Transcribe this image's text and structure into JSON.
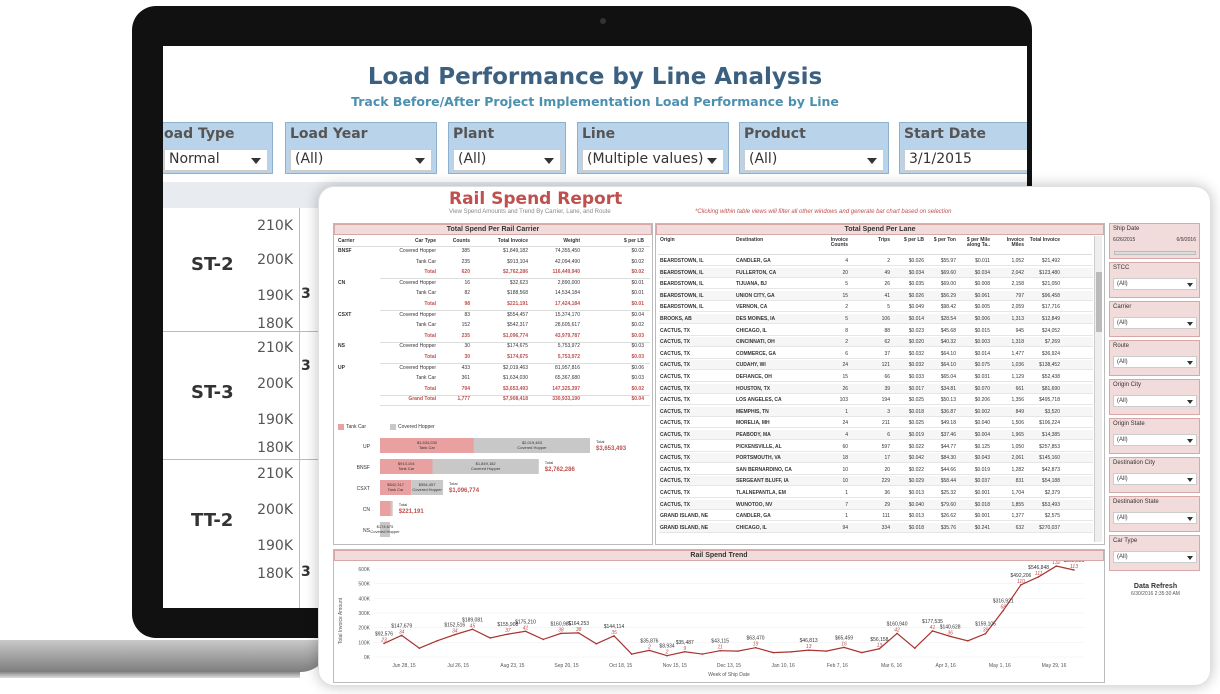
{
  "back_dashboard": {
    "title": "Load Performance by Line Analysis",
    "subtitle": "Track Before/After Project Implementation Load Performance by Line",
    "filters": [
      {
        "label": "oad Type",
        "value": "Normal"
      },
      {
        "label": "Load Year",
        "value": "(All)"
      },
      {
        "label": "Plant",
        "value": "(All)"
      },
      {
        "label": "Line",
        "value": "(Multiple values)"
      },
      {
        "label": "Product",
        "value": "(All)"
      },
      {
        "label": "Start Date",
        "value": "3/1/2015"
      }
    ],
    "rows": [
      {
        "name": "ST-2",
        "ticks": [
          "210K",
          "200K",
          "190K",
          "180K"
        ],
        "stub": "3"
      },
      {
        "name": "ST-3",
        "ticks": [
          "210K",
          "200K",
          "190K",
          "180K"
        ],
        "stub": "3"
      },
      {
        "name": "TT-2",
        "ticks": [
          "210K",
          "200K",
          "190K",
          "180K"
        ],
        "stub": "3"
      }
    ]
  },
  "report": {
    "title": "Rail Spend Report",
    "subtitle": "View Spend Amounts and Trend By Carrier, Lane, and Route",
    "note": "*Clicking within table views will filter all other windows and generate bar chart based on selection",
    "carrier_table": {
      "header": "Total Spend Per Rail Carrier",
      "columns": [
        "Carrier",
        "Car Type",
        "Counts",
        "Total Invoice",
        "Weight",
        "$ per LB"
      ],
      "rows": [
        {
          "carrier": "BNSF",
          "type": "Covered Hopper",
          "counts": "385",
          "invoice": "$1,849,182",
          "weight": "74,355,450",
          "perlb": "$0.02",
          "kind": "n"
        },
        {
          "carrier": "",
          "type": "Tank Car",
          "counts": "235",
          "invoice": "$913,104",
          "weight": "42,094,490",
          "perlb": "$0.02",
          "kind": "n"
        },
        {
          "carrier": "",
          "type": "Total",
          "counts": "620",
          "invoice": "$2,762,286",
          "weight": "116,449,940",
          "perlb": "$0.02",
          "kind": "t"
        },
        {
          "carrier": "CN",
          "type": "Covered Hopper",
          "counts": "16",
          "invoice": "$32,623",
          "weight": "2,890,000",
          "perlb": "$0.01",
          "kind": "n"
        },
        {
          "carrier": "",
          "type": "Tank Car",
          "counts": "82",
          "invoice": "$188,568",
          "weight": "14,534,184",
          "perlb": "$0.01",
          "kind": "n"
        },
        {
          "carrier": "",
          "type": "Total",
          "counts": "98",
          "invoice": "$221,191",
          "weight": "17,424,184",
          "perlb": "$0.01",
          "kind": "t"
        },
        {
          "carrier": "CSXT",
          "type": "Covered Hopper",
          "counts": "83",
          "invoice": "$554,457",
          "weight": "15,374,170",
          "perlb": "$0.04",
          "kind": "n"
        },
        {
          "carrier": "",
          "type": "Tank Car",
          "counts": "152",
          "invoice": "$542,317",
          "weight": "28,605,617",
          "perlb": "$0.02",
          "kind": "n"
        },
        {
          "carrier": "",
          "type": "Total",
          "counts": "235",
          "invoice": "$1,096,774",
          "weight": "43,979,787",
          "perlb": "$0.03",
          "kind": "t"
        },
        {
          "carrier": "NS",
          "type": "Covered Hopper",
          "counts": "30",
          "invoice": "$174,675",
          "weight": "5,753,972",
          "perlb": "$0.03",
          "kind": "n"
        },
        {
          "carrier": "",
          "type": "Total",
          "counts": "30",
          "invoice": "$174,675",
          "weight": "5,753,972",
          "perlb": "$0.03",
          "kind": "t"
        },
        {
          "carrier": "UP",
          "type": "Covered Hopper",
          "counts": "433",
          "invoice": "$2,019,463",
          "weight": "81,957,816",
          "perlb": "$0.06",
          "kind": "n"
        },
        {
          "carrier": "",
          "type": "Tank Car",
          "counts": "361",
          "invoice": "$1,634,030",
          "weight": "65,367,680",
          "perlb": "$0.03",
          "kind": "n"
        },
        {
          "carrier": "",
          "type": "Total",
          "counts": "794",
          "invoice": "$3,653,493",
          "weight": "147,325,397",
          "perlb": "$0.02",
          "kind": "t"
        },
        {
          "carrier": "",
          "type": "Grand Total",
          "counts": "1,777",
          "invoice": "$7,908,418",
          "weight": "330,933,190",
          "perlb": "$0.04",
          "kind": "g"
        }
      ],
      "legend": [
        "Tank Car",
        "Covered Hopper"
      ],
      "bars": [
        {
          "carrier": "UP",
          "tank": 1634030,
          "hopper": 2019463,
          "tank_label": "$1,634,030",
          "hopper_label": "$2,019,463",
          "total_label": "$3,653,493"
        },
        {
          "carrier": "BNSF",
          "tank": 913104,
          "hopper": 1849182,
          "tank_label": "$913,104",
          "hopper_label": "$1,849,182",
          "total_label": "$2,762,286"
        },
        {
          "carrier": "CSXT",
          "tank": 542317,
          "hopper": 554457,
          "tank_label": "$542,317",
          "hopper_label": "$554,457",
          "total_label": "$1,096,774"
        },
        {
          "carrier": "CN",
          "tank": 188568,
          "hopper": 32623,
          "tank_label": "",
          "hopper_label": "",
          "total_label": "$221,191"
        },
        {
          "carrier": "NS",
          "tank": 0,
          "hopper": 174675,
          "tank_label": "",
          "hopper_label": "$174,675",
          "total_label": ""
        }
      ],
      "bar_tank_text": "Tank Car",
      "bar_hopper_text": "Covered Hopper",
      "bar_total_text": "Total"
    },
    "lane_table": {
      "header": "Total Spend Per Lane",
      "columns": [
        "Origin",
        "Destination",
        "Invoice Counts",
        "Trips",
        "$ per LB",
        "$ per Ton",
        "$ per Mile along Ta..",
        "Invoice Miles",
        "Total Invoice"
      ],
      "rows": [
        [
          "BEARDSTOWN, IL",
          "CANDLER, GA",
          "4",
          "2",
          "$0.026",
          "$55.97",
          "$0.011",
          "1,052",
          "$21,492"
        ],
        [
          "BEARDSTOWN, IL",
          "FULLERTON, CA",
          "20",
          "49",
          "$0.034",
          "$69.60",
          "$0.034",
          "2,042",
          "$123,480"
        ],
        [
          "BEARDSTOWN, IL",
          "TIJUANA, BJ",
          "5",
          "26",
          "$0.035",
          "$69.00",
          "$0.008",
          "2,158",
          "$21,050"
        ],
        [
          "BEARDSTOWN, IL",
          "UNION CITY, GA",
          "15",
          "41",
          "$0.026",
          "$56.29",
          "$0.061",
          "797",
          "$96,458"
        ],
        [
          "BEARDSTOWN, IL",
          "VERNON, CA",
          "2",
          "5",
          "$0.049",
          "$98.42",
          "$0.005",
          "2,059",
          "$17,716"
        ],
        [
          "BROOKS, AB",
          "DES MOINES, IA",
          "5",
          "106",
          "$0.014",
          "$28.54",
          "$0.006",
          "1,313",
          "$12,849"
        ],
        [
          "CACTUS, TX",
          "CHICAGO, IL",
          "8",
          "88",
          "$0.023",
          "$45.68",
          "$0.015",
          "945",
          "$24,052"
        ],
        [
          "CACTUS, TX",
          "CINCINNATI, OH",
          "2",
          "62",
          "$0.020",
          "$40.32",
          "$0.003",
          "1,318",
          "$7,269"
        ],
        [
          "CACTUS, TX",
          "COMMERCE, GA",
          "6",
          "37",
          "$0.032",
          "$64.10",
          "$0.014",
          "1,477",
          "$36,924"
        ],
        [
          "CACTUS, TX",
          "CUDAHY, WI",
          "24",
          "121",
          "$0.032",
          "$64.10",
          "$0.075",
          "1,036",
          "$138,452"
        ],
        [
          "CACTUS, TX",
          "DEFIANCE, OH",
          "15",
          "66",
          "$0.033",
          "$65.04",
          "$0.031",
          "1,129",
          "$52,438"
        ],
        [
          "CACTUS, TX",
          "HOUSTON, TX",
          "26",
          "39",
          "$0.017",
          "$34.81",
          "$0.070",
          "661",
          "$81,690"
        ],
        [
          "CACTUS, TX",
          "LOS ANGELES, CA",
          "103",
          "194",
          "$0.025",
          "$50.13",
          "$0.206",
          "1,356",
          "$495,718"
        ],
        [
          "CACTUS, TX",
          "MEMPHIS, TN",
          "1",
          "3",
          "$0.018",
          "$36.87",
          "$0.002",
          "849",
          "$3,520"
        ],
        [
          "CACTUS, TX",
          "MORELIA, MH",
          "24",
          "211",
          "$0.025",
          "$49.18",
          "$0.040",
          "1,506",
          "$106,224"
        ],
        [
          "CACTUS, TX",
          "PEABODY, MA",
          "4",
          "6",
          "$0.019",
          "$37.46",
          "$0.004",
          "1,965",
          "$14,385"
        ],
        [
          "CACTUS, TX",
          "PICKENSVILLE, AL",
          "60",
          "597",
          "$0.022",
          "$44.77",
          "$0.125",
          "1,050",
          "$257,853"
        ],
        [
          "CACTUS, TX",
          "PORTSMOUTH, VA",
          "18",
          "17",
          "$0.042",
          "$84.30",
          "$0.043",
          "2,061",
          "$145,160"
        ],
        [
          "CACTUS, TX",
          "SAN BERNARDINO, CA",
          "10",
          "20",
          "$0.022",
          "$44.66",
          "$0.019",
          "1,282",
          "$42,873"
        ],
        [
          "CACTUS, TX",
          "SERGEANT BLUFF, IA",
          "10",
          "229",
          "$0.029",
          "$58.44",
          "$0.037",
          "831",
          "$54,188"
        ],
        [
          "CACTUS, TX",
          "TLALNEPANTLA, EM",
          "1",
          "36",
          "$0.013",
          "$25.32",
          "$0.001",
          "1,704",
          "$2,379"
        ],
        [
          "CACTUS, TX",
          "WUNOTOO, NV",
          "7",
          "29",
          "$0.040",
          "$79.60",
          "$0.018",
          "1,855",
          "$53,493"
        ],
        [
          "GRAND ISLAND, NE",
          "CANDLER, GA",
          "1",
          "111",
          "$0.013",
          "$26.62",
          "$0.001",
          "1,377",
          "$2,575"
        ],
        [
          "GRAND ISLAND, NE",
          "CHICAGO, IL",
          "94",
          "334",
          "$0.018",
          "$35.76",
          "$0.241",
          "632",
          "$270,037"
        ]
      ]
    },
    "filters": [
      {
        "label": "Ship Date",
        "value": "",
        "from": "6/26/2015",
        "to": "6/9/2016",
        "slider": true
      },
      {
        "label": "STCC",
        "value": "(All)"
      },
      {
        "label": "Carrier",
        "value": "(All)"
      },
      {
        "label": "Route",
        "value": "(All)"
      },
      {
        "label": "Origin City",
        "value": "(All)"
      },
      {
        "label": "Origin State",
        "value": "(All)"
      },
      {
        "label": "Destination City",
        "value": "(All)"
      },
      {
        "label": "Destination State",
        "value": "(All)"
      },
      {
        "label": "Car Type",
        "value": "(All)"
      }
    ],
    "data_refresh": {
      "label": "Data Refresh",
      "date": "6/30/2016 2:35:30 AM"
    }
  },
  "chart_data": {
    "type": "line",
    "title": "Rail Spend Trend",
    "xlabel": "Week of Ship Date",
    "ylabel": "Total Invoice Amount",
    "ylim": [
      0,
      600000
    ],
    "yticks": [
      "0K",
      "100K",
      "200K",
      "300K",
      "400K",
      "500K",
      "600K"
    ],
    "xticks": [
      "Jun 28, 15",
      "Jul 26, 15",
      "Aug 23, 15",
      "Sep 20, 15",
      "Oct 18, 15",
      "Nov 15, 15",
      "Dec 13, 15",
      "Jan 10, 16",
      "Feb 7, 16",
      "Mar 6, 16",
      "Apr 3, 16",
      "May 1, 16",
      "May 29, 16"
    ],
    "series": [
      {
        "values": [
          92576,
          147679,
          60000,
          110000,
          152516,
          189081,
          130000,
          155908,
          175210,
          120000,
          160985,
          164253,
          90000,
          144114,
          20000,
          45000,
          8934,
          35487,
          20000,
          43115,
          40000,
          63470,
          30000,
          35000,
          46813,
          40000,
          65459,
          30000,
          56158,
          160940,
          60000,
          177535,
          140628,
          110000,
          159105,
          316921,
          492206,
          546848,
          620000,
          593231
        ]
      }
    ],
    "labels": [
      {
        "i": 0,
        "amt": "$92,576",
        "cnt": "23"
      },
      {
        "i": 1,
        "amt": "$147,679",
        "cnt": "34"
      },
      {
        "i": 4,
        "amt": "$152,516",
        "cnt": "34"
      },
      {
        "i": 5,
        "amt": "$189,081",
        "cnt": "45"
      },
      {
        "i": 7,
        "amt": "$155,908",
        "cnt": "37"
      },
      {
        "i": 8,
        "amt": "$175,210",
        "cnt": "41"
      },
      {
        "i": 10,
        "amt": "$160,985",
        "cnt": "38"
      },
      {
        "i": 11,
        "amt": "$164,253",
        "cnt": "38"
      },
      {
        "i": 13,
        "amt": "$144,114",
        "cnt": "35"
      },
      {
        "i": 15,
        "amt": "$35,876",
        "cnt": "2"
      },
      {
        "i": 16,
        "amt": "$8,934",
        "cnt": "2"
      },
      {
        "i": 17,
        "amt": "$35,487",
        "cnt": "9"
      },
      {
        "i": 19,
        "amt": "$43,115",
        "cnt": "11"
      },
      {
        "i": 21,
        "amt": "$63,470",
        "cnt": "19"
      },
      {
        "i": 24,
        "amt": "$46,813",
        "cnt": "13"
      },
      {
        "i": 26,
        "amt": "$65,459",
        "cnt": "16"
      },
      {
        "i": 28,
        "amt": "$56,158",
        "cnt": "13"
      },
      {
        "i": 29,
        "amt": "$160,940",
        "cnt": "42"
      },
      {
        "i": 31,
        "amt": "$177,535",
        "cnt": "41"
      },
      {
        "i": 32,
        "amt": "$140,628",
        "cnt": "36"
      },
      {
        "i": 34,
        "amt": "$159,105",
        "cnt": "39"
      },
      {
        "i": 35,
        "amt": "$316,921",
        "cnt": "68"
      },
      {
        "i": 36,
        "amt": "$492,206",
        "cnt": "110"
      },
      {
        "i": 37,
        "amt": "$546,848",
        "cnt": "111"
      },
      {
        "i": 38,
        "amt": "$620,000",
        "cnt": "132"
      },
      {
        "i": 39,
        "amt": "$593,231",
        "cnt": "113"
      }
    ]
  },
  "colors": {
    "accent": "#c0504d",
    "tank": "#e8a0a0",
    "hopper": "#c8c8c8",
    "header_bg": "#f2dcdb",
    "back_filter": "#b9d3ea",
    "back_title": "#3c6080"
  }
}
